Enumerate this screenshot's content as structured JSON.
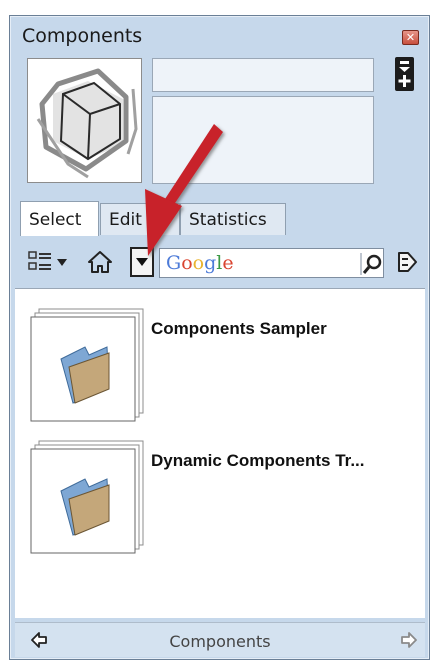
{
  "window": {
    "title": "Components"
  },
  "tabs": [
    {
      "label": "Select",
      "active": true
    },
    {
      "label": "Edit",
      "active": false
    },
    {
      "label": "Statistics",
      "active": false
    }
  ],
  "search": {
    "value": "",
    "placeholder_parts": [
      "G",
      "o",
      "o",
      "g",
      "l",
      "e"
    ]
  },
  "items": [
    {
      "label": "Components Sampler",
      "icon": "folder-icon"
    },
    {
      "label": "Dynamic Components Tr...",
      "icon": "folder-icon"
    }
  ],
  "statusbar": {
    "text": "Components"
  },
  "colors": {
    "window_bg": "#c6d8eb",
    "annotation_arrow": "#c8202a"
  }
}
